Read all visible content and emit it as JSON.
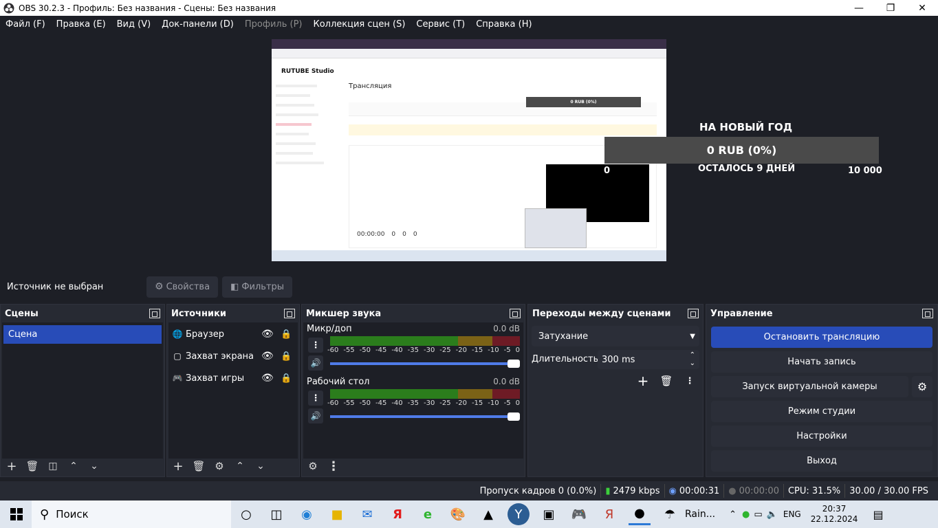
{
  "window": {
    "title": "OBS 30.2.3 - Профиль: Без названия - Сцены: Без названия"
  },
  "menu": {
    "items": [
      "Файл (F)",
      "Правка (E)",
      "Вид (V)",
      "Док-панели (D)",
      "Профиль (P)",
      "Коллекция сцен (S)",
      "Сервис (T)",
      "Справка (H)"
    ]
  },
  "preview": {
    "browser_page_title": "Трансляция",
    "browser_brand": "RUTUBE Studio",
    "inner_widget": "0 RUB (0%)",
    "inner_stats": [
      "00:00:00",
      "0",
      "0",
      "0"
    ],
    "overlay_heading": "НА НОВЫЙ ГОД",
    "overlay_progress": "0 RUB (0%)",
    "overlay_remaining": "ОСТАЛОСЬ 9 ДНЕЙ",
    "overlay_min": "0",
    "overlay_max": "10 000"
  },
  "source_bar": {
    "status": "Источник не выбран",
    "properties_label": "Свойства",
    "filters_label": "Фильтры"
  },
  "docks": {
    "scenes": {
      "title": "Сцены",
      "items": [
        "Сцена"
      ]
    },
    "sources": {
      "title": "Источники",
      "items": [
        "Браузер",
        "Захват экрана",
        "Захват игры"
      ]
    },
    "mixer": {
      "title": "Микшер звука",
      "channels": [
        {
          "name": "Микр/доп",
          "db": "0.0 dB"
        },
        {
          "name": "Рабочий стол",
          "db": "0.0 dB"
        }
      ],
      "ticks": [
        "-60",
        "-55",
        "-50",
        "-45",
        "-40",
        "-35",
        "-30",
        "-25",
        "-20",
        "-15",
        "-10",
        "-5",
        "0"
      ]
    },
    "transitions": {
      "title": "Переходы между сценами",
      "selected": "Затухание",
      "duration_label": "Длительность",
      "duration_value": "300 ms"
    },
    "controls": {
      "title": "Управление",
      "buttons": [
        "Остановить трансляцию",
        "Начать запись",
        "Запуск виртуальной камеры",
        "Режим студии",
        "Настройки",
        "Выход"
      ],
      "accent": "#284cb8"
    }
  },
  "status": {
    "dropped_frames": "Пропуск кадров 0 (0.0%)",
    "bitrate": "2479 kbps",
    "stream_time": "00:00:31",
    "record_time": "00:00:00",
    "cpu": "CPU: 31.5%",
    "fps": "30.00 / 30.00 FPS"
  },
  "taskbar": {
    "search_placeholder": "Поиск",
    "weather_app": "Rain...",
    "language": "ENG",
    "time": "20:37",
    "date": "22.12.2024"
  }
}
